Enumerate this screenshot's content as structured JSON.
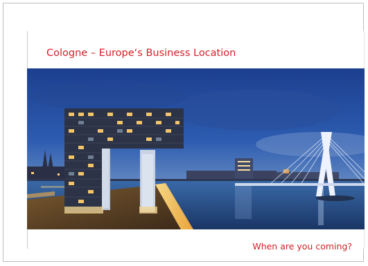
{
  "slide": {
    "title": "Cologne – Europe‘s Business Location",
    "tagline": "When are you coming?"
  },
  "colors": {
    "accent": "#d21f26",
    "frame_border": "#bdbdbd"
  },
  "icons": [
    "photo-cologne-skyline"
  ]
}
